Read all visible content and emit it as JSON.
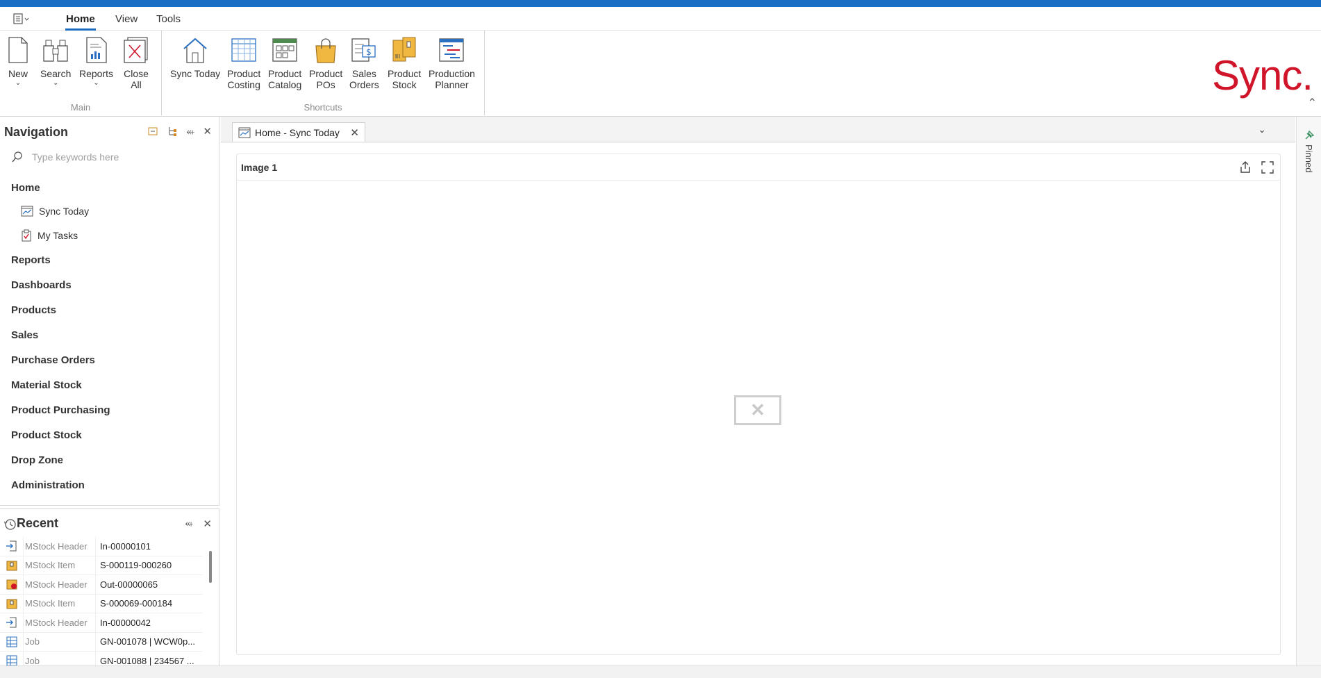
{
  "menu": {
    "tabs": [
      {
        "label": "Home",
        "active": true
      },
      {
        "label": "View",
        "active": false
      },
      {
        "label": "Tools",
        "active": false
      }
    ]
  },
  "ribbon": {
    "groups": {
      "main": {
        "label": "Main"
      },
      "shortcuts": {
        "label": "Shortcuts"
      }
    },
    "buttons": {
      "new": "New",
      "search": "Search",
      "reports": "Reports",
      "close_all": "Close\nAll",
      "sync_today": "Sync Today",
      "product_costing": "Product\nCosting",
      "product_catalog": "Product\nCatalog",
      "product_pos": "Product\nPOs",
      "sales_orders": "Sales\nOrders",
      "product_stock": "Product\nStock",
      "production_planner": "Production\nPlanner"
    },
    "logo_text": "Sync."
  },
  "navigation": {
    "title": "Navigation",
    "search_placeholder": "Type keywords here",
    "groups": {
      "home": "Home",
      "reports": "Reports",
      "dashboards": "Dashboards",
      "products": "Products",
      "sales": "Sales",
      "purchase_orders": "Purchase Orders",
      "material_stock": "Material Stock",
      "product_purchasing": "Product Purchasing",
      "product_stock": "Product Stock",
      "drop_zone": "Drop Zone",
      "administration": "Administration"
    },
    "home_items": {
      "sync_today": "Sync Today",
      "my_tasks": "My Tasks"
    }
  },
  "recent": {
    "title": "Recent",
    "items": [
      {
        "type": "MStock Header",
        "value": "In-00000101",
        "icon": "stock-in-icon"
      },
      {
        "type": "MStock Item",
        "value": "S-000119-000260",
        "icon": "stock-item-icon"
      },
      {
        "type": "MStock Header",
        "value": "Out-00000065",
        "icon": "stock-out-icon"
      },
      {
        "type": "MStock Item",
        "value": "S-000069-000184",
        "icon": "stock-item-icon"
      },
      {
        "type": "MStock Header",
        "value": "In-00000042",
        "icon": "stock-in-icon"
      },
      {
        "type": "Job",
        "value": "GN-001078 | WCW0p...",
        "icon": "job-grid-icon"
      },
      {
        "type": "Job",
        "value": "GN-001088 | 234567 ...",
        "icon": "job-grid-icon"
      }
    ]
  },
  "document": {
    "tab_label": "Home - Sync Today",
    "card_title": "Image 1"
  },
  "pinned": {
    "label": "Pinned"
  },
  "colors": {
    "accent": "#1a6fc4",
    "logo": "#d0152a"
  }
}
